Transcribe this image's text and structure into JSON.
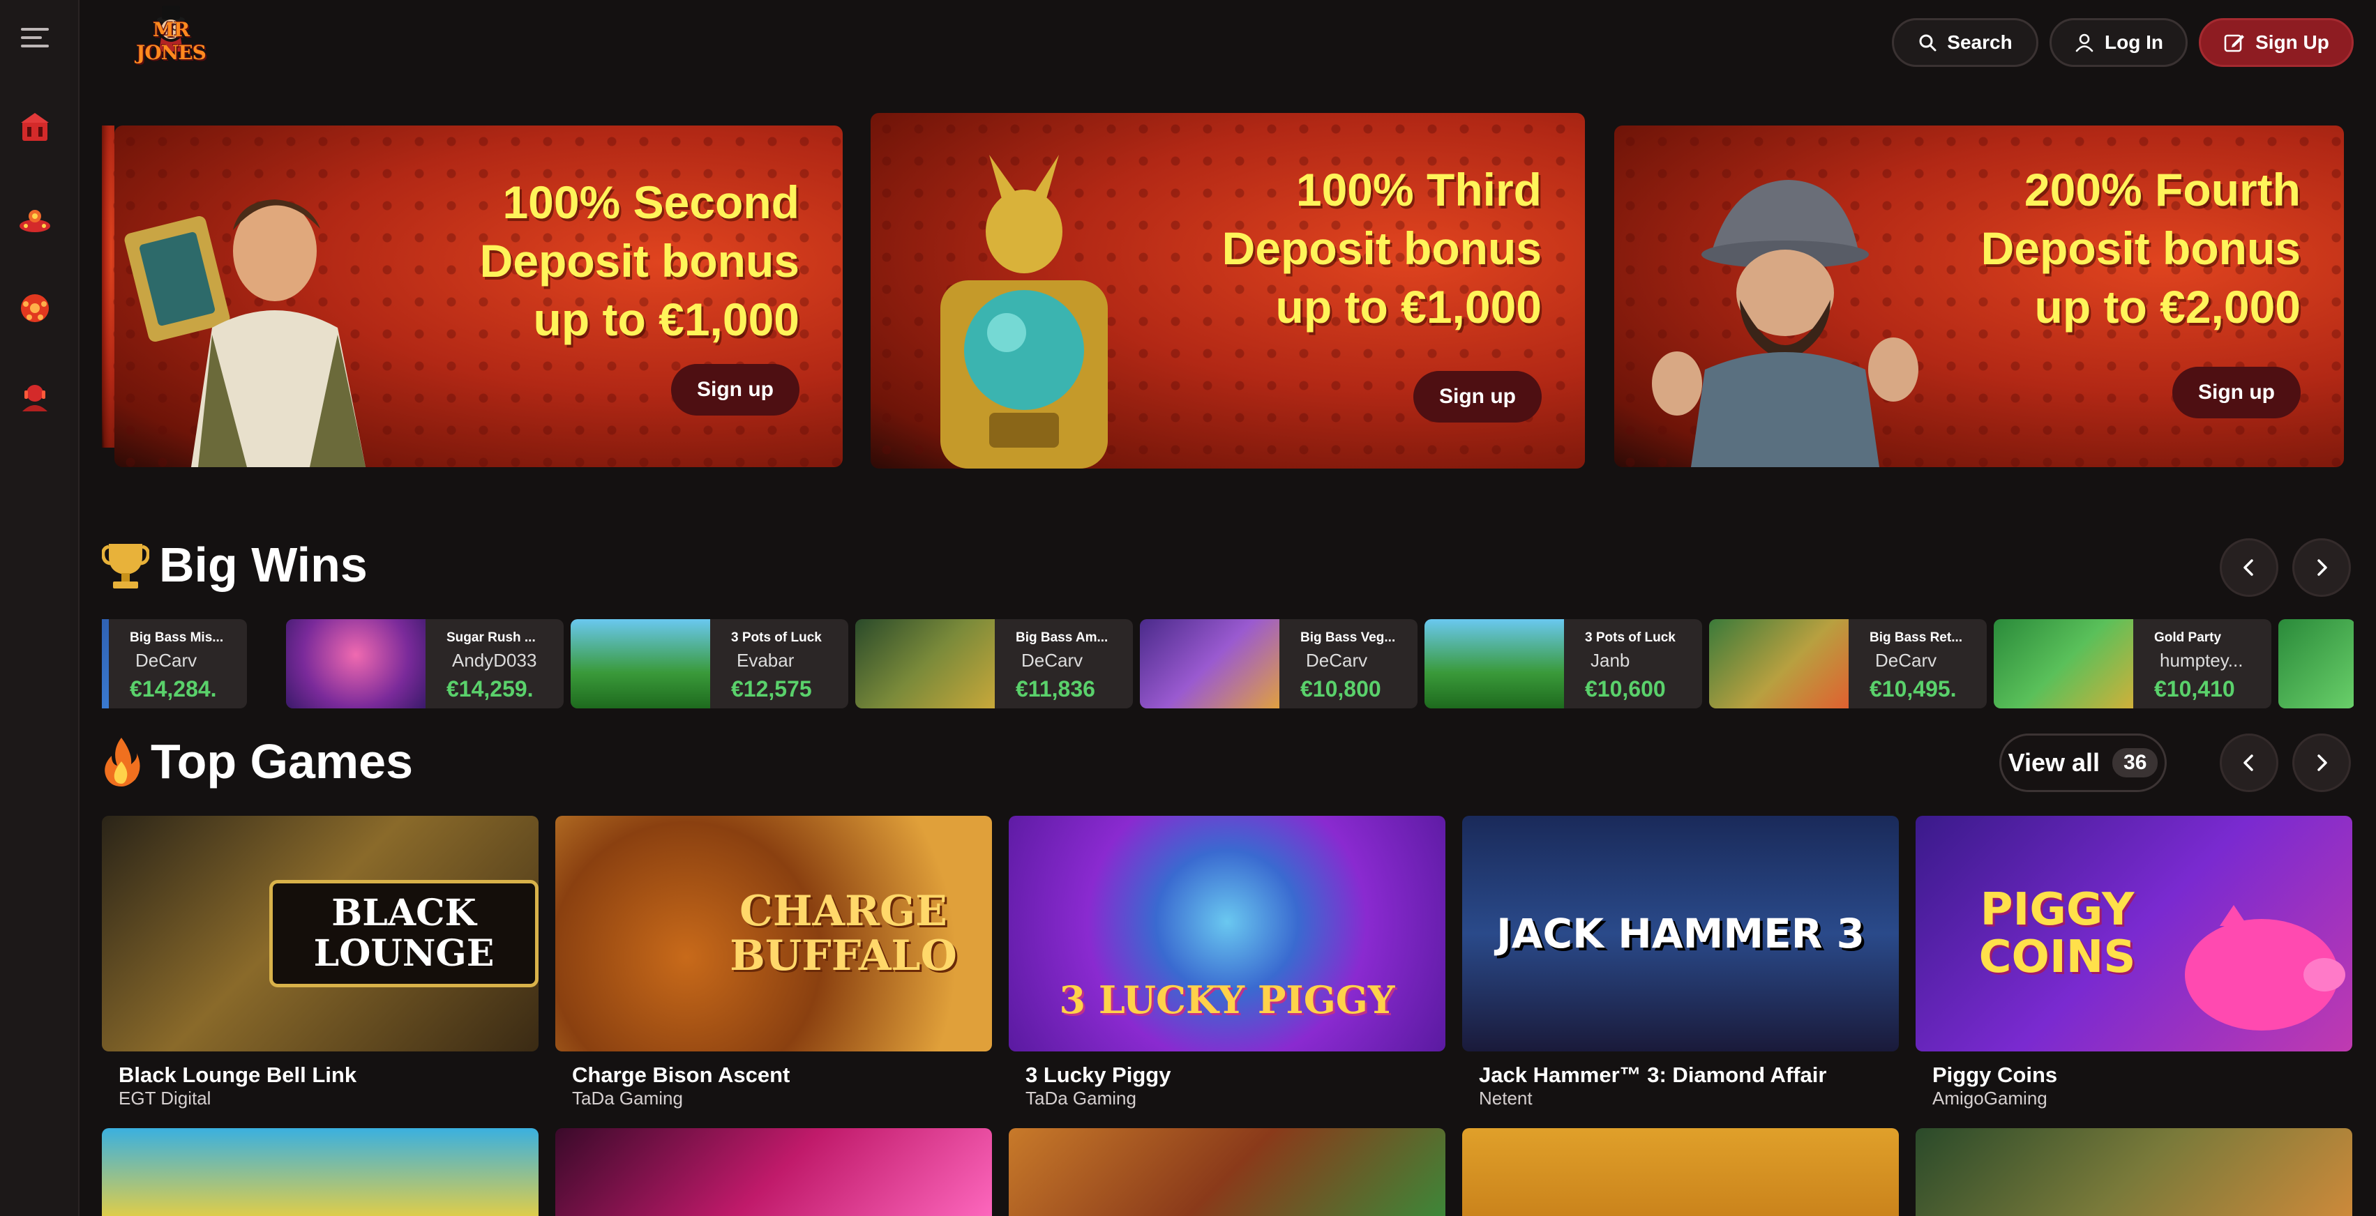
{
  "header": {
    "logo_text": "MR JONES",
    "search_label": "Search",
    "login_label": "Log In",
    "signup_label": "Sign Up"
  },
  "sidebar": {
    "items": [
      {
        "icon": "menu-icon"
      },
      {
        "icon": "casino-icon"
      },
      {
        "icon": "live-casino-icon"
      },
      {
        "icon": "sports-icon"
      },
      {
        "icon": "support-icon"
      }
    ]
  },
  "promos": [
    {
      "line1": "100% Second",
      "line2": "Deposit bonus",
      "line3": "up to €1,000",
      "cta": "Sign up"
    },
    {
      "line1": "100% Third",
      "line2": "Deposit bonus",
      "line3": "up to €1,000",
      "cta": "Sign up"
    },
    {
      "line1": "200% Fourth",
      "line2": "Deposit bonus",
      "line3": "up to €2,000",
      "cta": "Sign up"
    }
  ],
  "big_wins": {
    "title": "Big Wins",
    "items": [
      {
        "game": "Big Bass Mis...",
        "player": "DeCarv",
        "amount": "€14,284."
      },
      {
        "game": "Sugar Rush ...",
        "player": "AndyD033",
        "amount": "€14,259."
      },
      {
        "game": "3 Pots of Luck",
        "player": "Evabar",
        "amount": "€12,575"
      },
      {
        "game": "Big Bass Am...",
        "player": "DeCarv",
        "amount": "€11,836"
      },
      {
        "game": "Big Bass Veg...",
        "player": "DeCarv",
        "amount": "€10,800"
      },
      {
        "game": "3 Pots of Luck",
        "player": "Janb",
        "amount": "€10,600"
      },
      {
        "game": "Big Bass Ret...",
        "player": "DeCarv",
        "amount": "€10,495."
      },
      {
        "game": "Gold Party",
        "player": "humptey...",
        "amount": "€10,410"
      }
    ]
  },
  "top_games": {
    "title": "Top Games",
    "view_all_label": "View all",
    "view_all_count": "36",
    "games": [
      {
        "name": "Black Lounge Bell Link",
        "provider": "EGT Digital",
        "art": "BLACK LOUNGE"
      },
      {
        "name": "Charge Bison Ascent",
        "provider": "TaDa Gaming",
        "art": "CHARGE BUFFALO"
      },
      {
        "name": "3 Lucky Piggy",
        "provider": "TaDa Gaming",
        "art": "3 LUCKY PIGGY"
      },
      {
        "name": "Jack Hammer™ 3: Diamond Affair",
        "provider": "Netent",
        "art": "JACK HAMMER 3"
      },
      {
        "name": "Piggy Coins",
        "provider": "AmigoGaming",
        "art": "PIGGY COINS"
      }
    ]
  },
  "colors": {
    "background": "#141111",
    "accent": "#8e1c22",
    "win_amount": "#5ad16b",
    "promo_text": "#fff45a"
  }
}
